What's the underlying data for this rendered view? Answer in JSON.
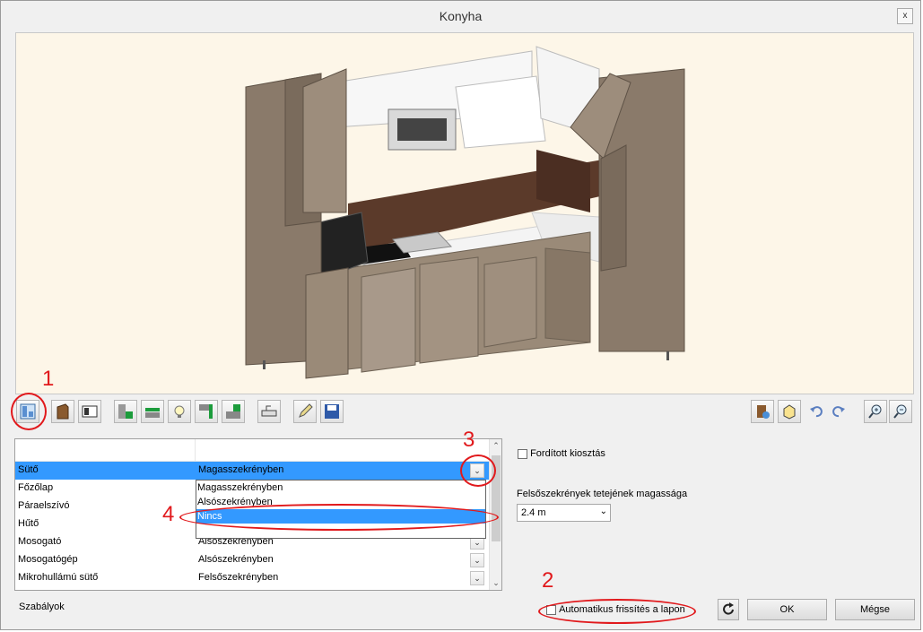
{
  "window": {
    "title": "Konyha",
    "close_glyph": "x"
  },
  "toolbar": {
    "left_icons": [
      "kitchen-layout-icon",
      "cabinet-icon",
      "front-panel-icon",
      "worktop-icon",
      "plinth-icon",
      "light-icon",
      "corner-panel-icon",
      "l-panel-icon",
      "sink-icon",
      "pencil-icon",
      "save-icon"
    ],
    "right_icons": [
      "furniture-edit-icon",
      "box-view-icon",
      "undo-icon",
      "redo-icon",
      "zoom-in-icon",
      "zoom-out-icon"
    ]
  },
  "appliance_table": {
    "rows": [
      {
        "name": "Sütő",
        "value": "Magasszekrényben",
        "selected": true
      },
      {
        "name": "Főzőlap",
        "value": ""
      },
      {
        "name": "Páraelszívó",
        "value": ""
      },
      {
        "name": "Hűtő",
        "value": ""
      },
      {
        "name": "Mosogató",
        "value": "Alsószekrényben"
      },
      {
        "name": "Mosogatógép",
        "value": "Alsószekrényben"
      },
      {
        "name": "Mikrohullámú sütő",
        "value": "Felsőszekrényben"
      }
    ],
    "dropdown_options": [
      {
        "label": "Magasszekrényben",
        "highlighted": false
      },
      {
        "label": "Alsószekrényben",
        "highlighted": false
      },
      {
        "label": "Nincs",
        "highlighted": true
      }
    ]
  },
  "options": {
    "reverse_layout_label": "Fordított kiosztás",
    "upper_height_label": "Felsőszekrények tetejének magassága",
    "upper_height_value": "2.4 m",
    "auto_refresh_label": "Automatikus frissítés a lapon"
  },
  "footer": {
    "rules_label": "Szabályok",
    "ok_label": "OK",
    "cancel_label": "Mégse"
  },
  "annotations": [
    "1",
    "2",
    "3",
    "4"
  ],
  "colors": {
    "annotation": "#e1191c",
    "selection": "#3399ff",
    "wood": "#8a7a6a",
    "backsplash": "#5b3a2a"
  }
}
